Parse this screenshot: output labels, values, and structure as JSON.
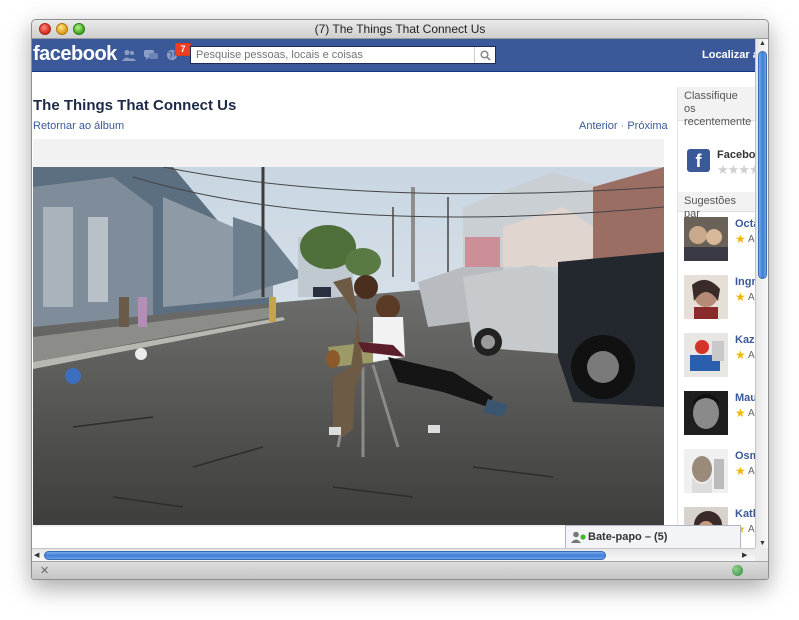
{
  "window": {
    "title": "(7) The Things That Connect Us"
  },
  "facebook": {
    "logo": "facebook",
    "notification_count": "7",
    "search_placeholder": "Pesquise pessoas, locais e coisas",
    "find_friends": "Localizar a"
  },
  "photo_page": {
    "album_title": "The Things That Connect Us",
    "back_link": "Retornar ao álbum",
    "previous": "Anterior",
    "separator": "·",
    "next": "Próxima"
  },
  "sidebar": {
    "rate_header": "Classifique os recentemente",
    "rated_page": {
      "icon": "f",
      "name": "Faceboo",
      "stars": "★★★★★"
    },
    "suggestions_header": "Sugestões par",
    "suggestions": [
      {
        "name": "Octa",
        "tag": "A"
      },
      {
        "name": "Ingr",
        "tag": "A"
      },
      {
        "name": "Kazu",
        "tag": "A"
      },
      {
        "name": "Mau",
        "tag": "A"
      },
      {
        "name": "Osm",
        "tag": "A"
      },
      {
        "name": "Kath",
        "tag": "A"
      }
    ]
  },
  "chat": {
    "label": "Bate-papo – (5)"
  },
  "statusbar": {
    "close_glyph": "✕"
  },
  "colors": {
    "facebook_blue": "#3b5998",
    "link": "#3b5998",
    "scroll_thumb": "#3f7fd8"
  }
}
